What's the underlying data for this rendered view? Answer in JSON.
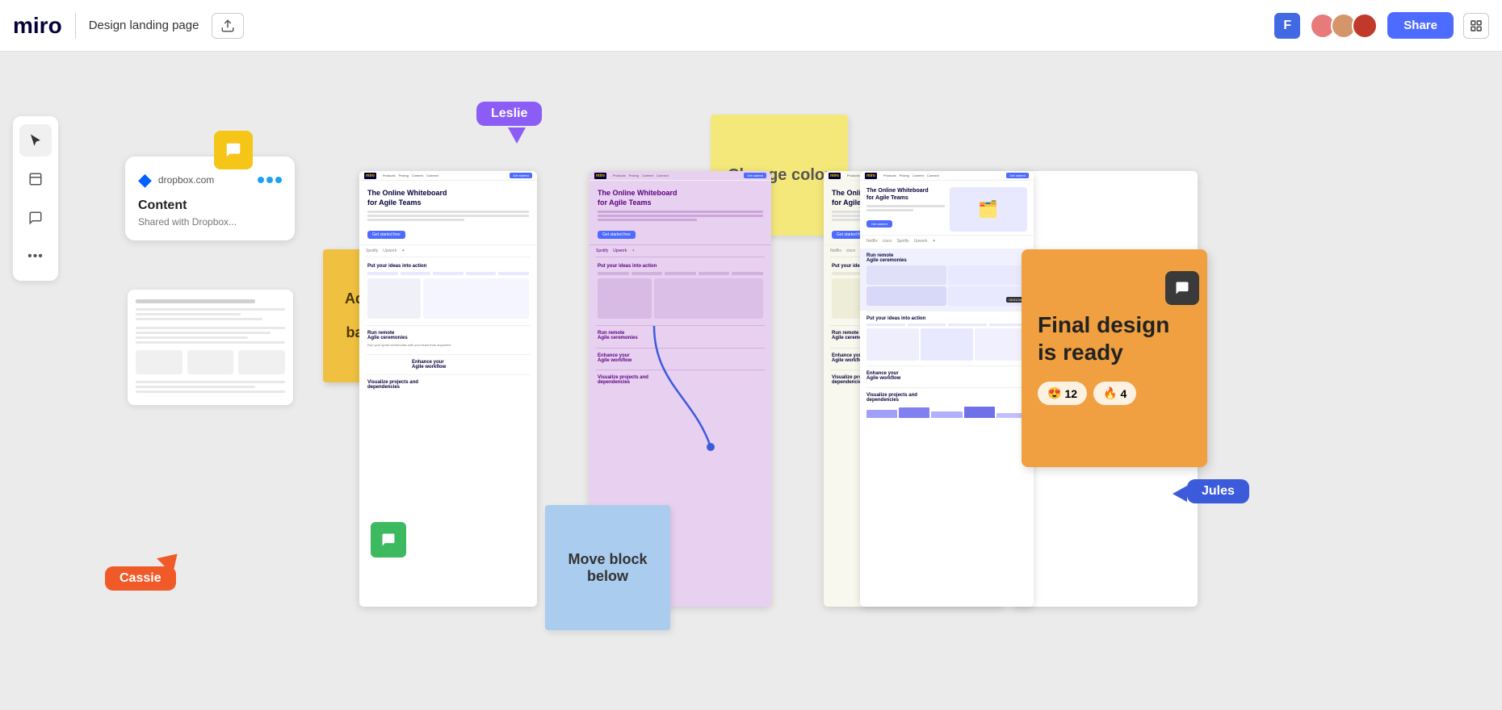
{
  "topbar": {
    "logo": "miro",
    "title": "Design landing page",
    "share_label": "Share",
    "menu_icon": "☰"
  },
  "sidebar": {
    "tools": [
      {
        "name": "cursor-tool",
        "icon": "↖",
        "active": true
      },
      {
        "name": "sticky-note-tool",
        "icon": "□"
      },
      {
        "name": "comment-tool",
        "icon": "💬"
      },
      {
        "name": "more-tools",
        "icon": "..."
      }
    ]
  },
  "canvas": {
    "dropbox_card": {
      "url": "dropbox.com",
      "content_title": "Content",
      "content_sub": "Shared with Dropbox..."
    },
    "stickies": {
      "add_color": "Add color to the background",
      "change_color": "Change color",
      "move_block": "Move block below",
      "final_design": "Final design is ready"
    },
    "users": {
      "leslie": {
        "name": "Leslie",
        "color": "#8b5cf6"
      },
      "cassie": {
        "name": "Cassie",
        "color": "#f05a28"
      },
      "jules": {
        "name": "Jules",
        "color": "#3b5bdb"
      }
    },
    "reactions": {
      "emoji": "😍",
      "count1": "12",
      "fire": "🔥",
      "count2": "4"
    }
  }
}
